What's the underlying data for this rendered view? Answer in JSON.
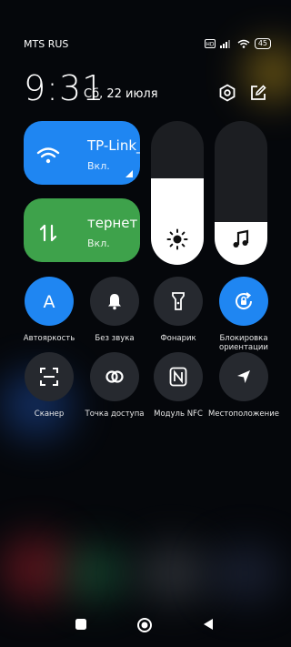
{
  "status_bar": {
    "carrier": "MTS RUS",
    "battery": "45"
  },
  "header": {
    "time": "9:31",
    "date": "Сб, 22 июля"
  },
  "tiles": {
    "wifi": {
      "title": "TP-Link_",
      "status": "Вкл.",
      "color": "#1f86f2"
    },
    "mobile_data": {
      "title": "тернет",
      "status": "Вкл.",
      "color": "#3ea24b"
    }
  },
  "sliders": {
    "brightness": {
      "level_percent": 60
    },
    "volume": {
      "level_percent": 30
    }
  },
  "toggles": [
    {
      "label": "Автояркость",
      "icon": "auto-brightness-icon",
      "active": true
    },
    {
      "label": "Без звука",
      "icon": "bell-icon",
      "active": false
    },
    {
      "label": "Фонарик",
      "icon": "flashlight-icon",
      "active": false
    },
    {
      "label": "Блокировка ориентации",
      "icon": "rotation-lock-icon",
      "active": true
    },
    {
      "label": "Сканер",
      "icon": "scanner-icon",
      "active": false
    },
    {
      "label": "Точка доступа",
      "icon": "hotspot-icon",
      "active": false
    },
    {
      "label": "Модуль NFC",
      "icon": "nfc-icon",
      "active": false
    },
    {
      "label": "Местоположение",
      "icon": "location-icon",
      "active": false
    }
  ],
  "colors": {
    "accent": "#1f86f2",
    "data_tile": "#3ea24b",
    "inactive_button": "#26292f"
  }
}
